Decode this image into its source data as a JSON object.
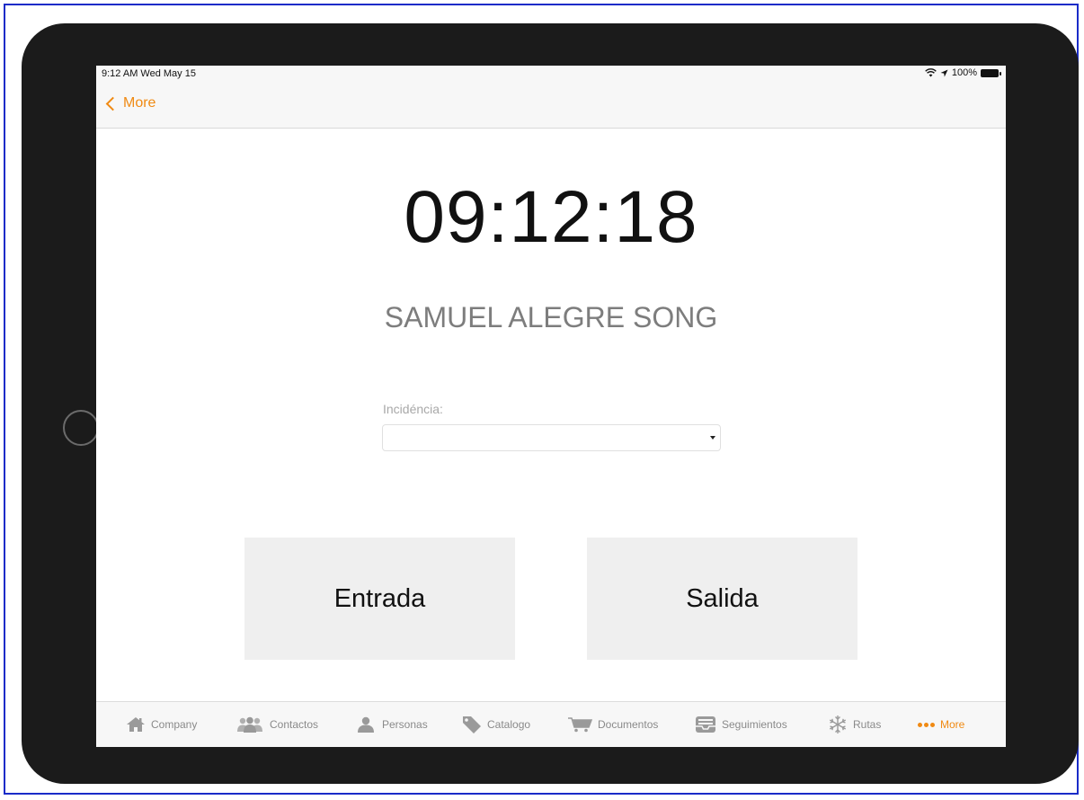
{
  "status_bar": {
    "time_date": "9:12 AM  Wed May 15",
    "battery": "100%",
    "icons": [
      "wifi-icon",
      "location-icon",
      "battery-icon"
    ]
  },
  "nav": {
    "back_label": "More"
  },
  "main": {
    "clock": "09:12:18",
    "user_name": "SAMUEL ALEGRE SONG",
    "incidencia_label": "Incidéncia:",
    "incidencia_value": "",
    "entrada_label": "Entrada",
    "salida_label": "Salida"
  },
  "tabs": [
    {
      "label": "Company",
      "icon": "home-icon",
      "active": false
    },
    {
      "label": "Contactos",
      "icon": "people-icon",
      "active": false
    },
    {
      "label": "Personas",
      "icon": "person-icon",
      "active": false
    },
    {
      "label": "Catalogo",
      "icon": "tag-icon",
      "active": false
    },
    {
      "label": "Documentos",
      "icon": "cart-icon",
      "active": false
    },
    {
      "label": "Seguimientos",
      "icon": "inbox-icon",
      "active": false
    },
    {
      "label": "Rutas",
      "icon": "snowflake-icon",
      "active": false
    },
    {
      "label": "More",
      "icon": "more-dots-icon",
      "active": true
    }
  ],
  "colors": {
    "accent": "#f08a13",
    "bezel": "#1b1b1b",
    "button_bg": "#efefef",
    "tab_inactive": "#8a8a8a"
  }
}
